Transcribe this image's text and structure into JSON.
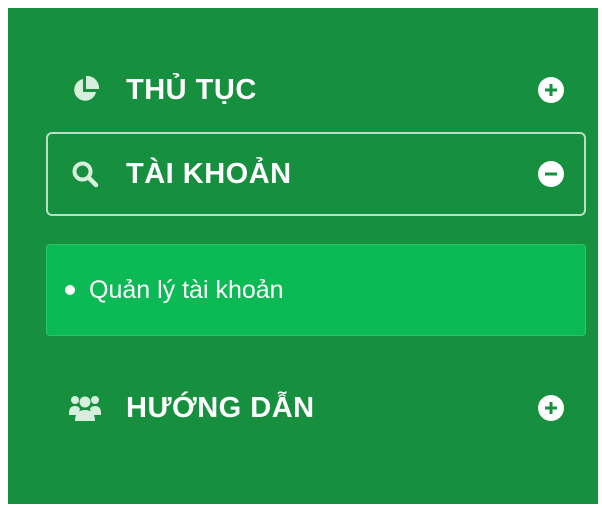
{
  "menu": {
    "items": [
      {
        "label": "THỦ TỤC",
        "icon": "pie-chart-icon",
        "toggle": "plus-circle-icon",
        "expanded": false
      },
      {
        "label": "TÀI KHOẢN",
        "icon": "search-icon",
        "toggle": "minus-circle-icon",
        "expanded": true,
        "submenu": [
          {
            "label": "Quản lý tài khoản",
            "icon": "bullet-icon"
          }
        ]
      },
      {
        "label": "HƯỚNG DẪN",
        "icon": "users-icon",
        "toggle": "plus-circle-icon",
        "expanded": false
      }
    ]
  },
  "colors": {
    "panel_background": "#168f3e",
    "submenu_background": "#0bb955",
    "active_border": "#b9e0c3",
    "text": "#ffffff"
  }
}
